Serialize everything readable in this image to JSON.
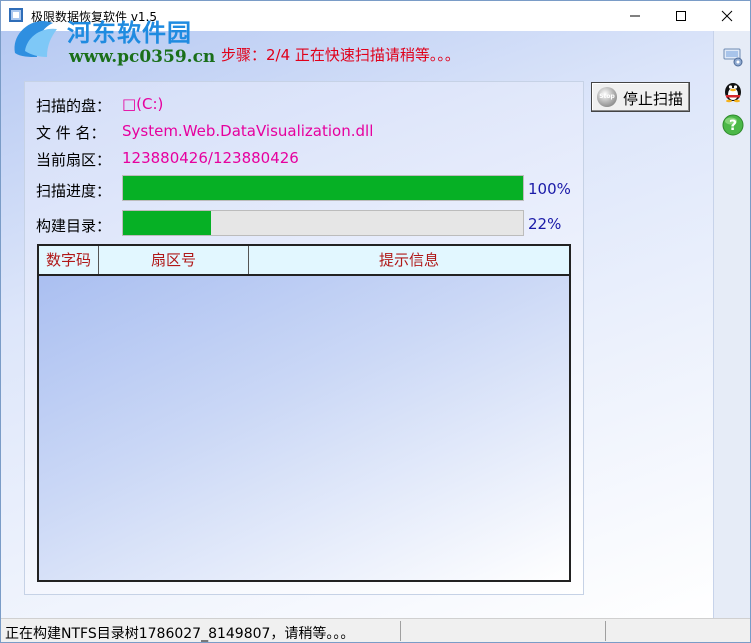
{
  "window": {
    "title": "极限数据恢复软件 v1.5",
    "minimize_glyph": "—",
    "maximize_glyph": "☐",
    "close_glyph": "✕"
  },
  "watermark": {
    "name": "河东软件园",
    "url": "www.pc0359.cn"
  },
  "step_text": "步骤：2/4 正在快速扫描请稍等。。。",
  "fields": {
    "disk_label": "扫描的盘：",
    "disk_value": "□(C:)",
    "file_label": "文 件 名：",
    "file_value": "System.Web.DataVisualization.dll",
    "sector_label": "当前扇区：",
    "sector_value": "123880426/123880426"
  },
  "progress": {
    "scan_label": "扫描进度：",
    "scan_percent_text": "100%",
    "scan_fraction": 1.0,
    "build_label": "构建目录：",
    "build_percent_text": "22%",
    "build_fraction": 0.22,
    "fill_color": "#06b025"
  },
  "table": {
    "headers": [
      "数字码",
      "扇区号",
      "提示信息"
    ],
    "rows": []
  },
  "stop_button": {
    "icon_text": "Stop",
    "label": "停止扫描"
  },
  "sidebar_icons": [
    "settings-network-icon",
    "qq-penguin-icon",
    "help-icon"
  ],
  "status": {
    "text": "正在构建NTFS目录树1786027_8149807，请稍等。。。"
  }
}
